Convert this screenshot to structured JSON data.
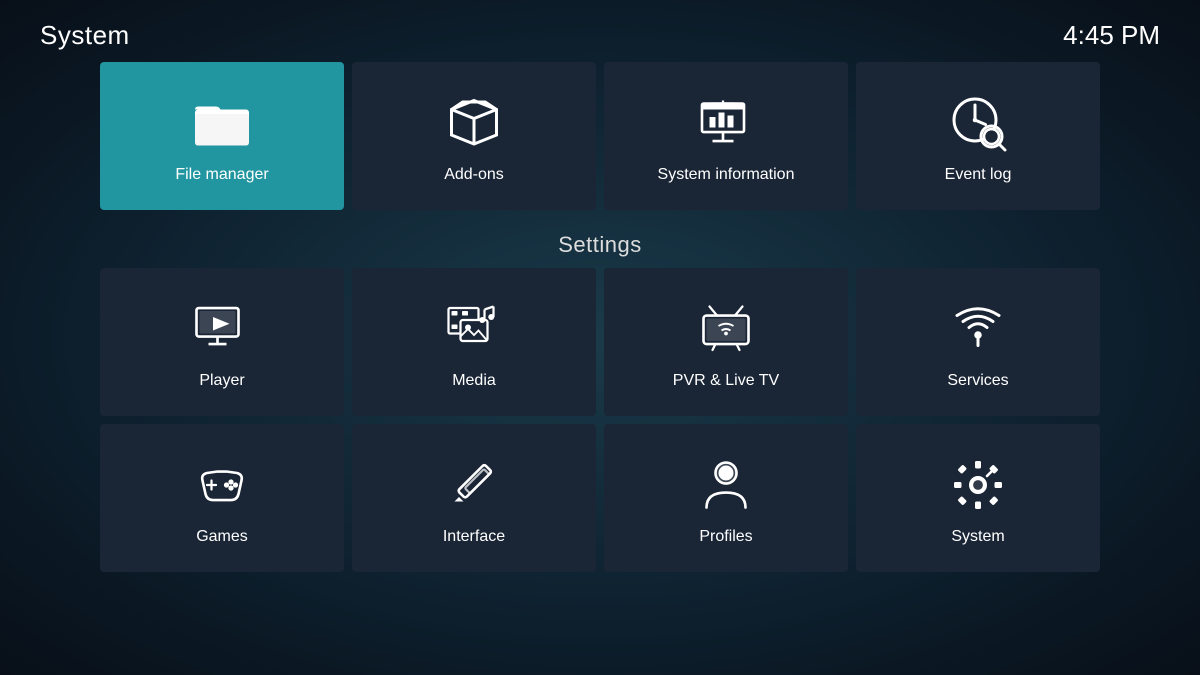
{
  "header": {
    "title": "System",
    "time": "4:45 PM"
  },
  "top_tiles": [
    {
      "id": "file-manager",
      "label": "File manager",
      "icon": "folder",
      "active": true
    },
    {
      "id": "add-ons",
      "label": "Add-ons",
      "icon": "addons",
      "active": false
    },
    {
      "id": "system-information",
      "label": "System information",
      "icon": "sysinfo",
      "active": false
    },
    {
      "id": "event-log",
      "label": "Event log",
      "icon": "eventlog",
      "active": false
    }
  ],
  "settings_label": "Settings",
  "settings_tiles": [
    {
      "id": "player",
      "label": "Player",
      "icon": "player",
      "active": false
    },
    {
      "id": "media",
      "label": "Media",
      "icon": "media",
      "active": false
    },
    {
      "id": "pvr-live-tv",
      "label": "PVR & Live TV",
      "icon": "pvr",
      "active": false
    },
    {
      "id": "services",
      "label": "Services",
      "icon": "services",
      "active": false
    },
    {
      "id": "games",
      "label": "Games",
      "icon": "games",
      "active": false
    },
    {
      "id": "interface",
      "label": "Interface",
      "icon": "interface",
      "active": false
    },
    {
      "id": "profiles",
      "label": "Profiles",
      "icon": "profiles",
      "active": false
    },
    {
      "id": "system",
      "label": "System",
      "icon": "system",
      "active": false
    }
  ]
}
